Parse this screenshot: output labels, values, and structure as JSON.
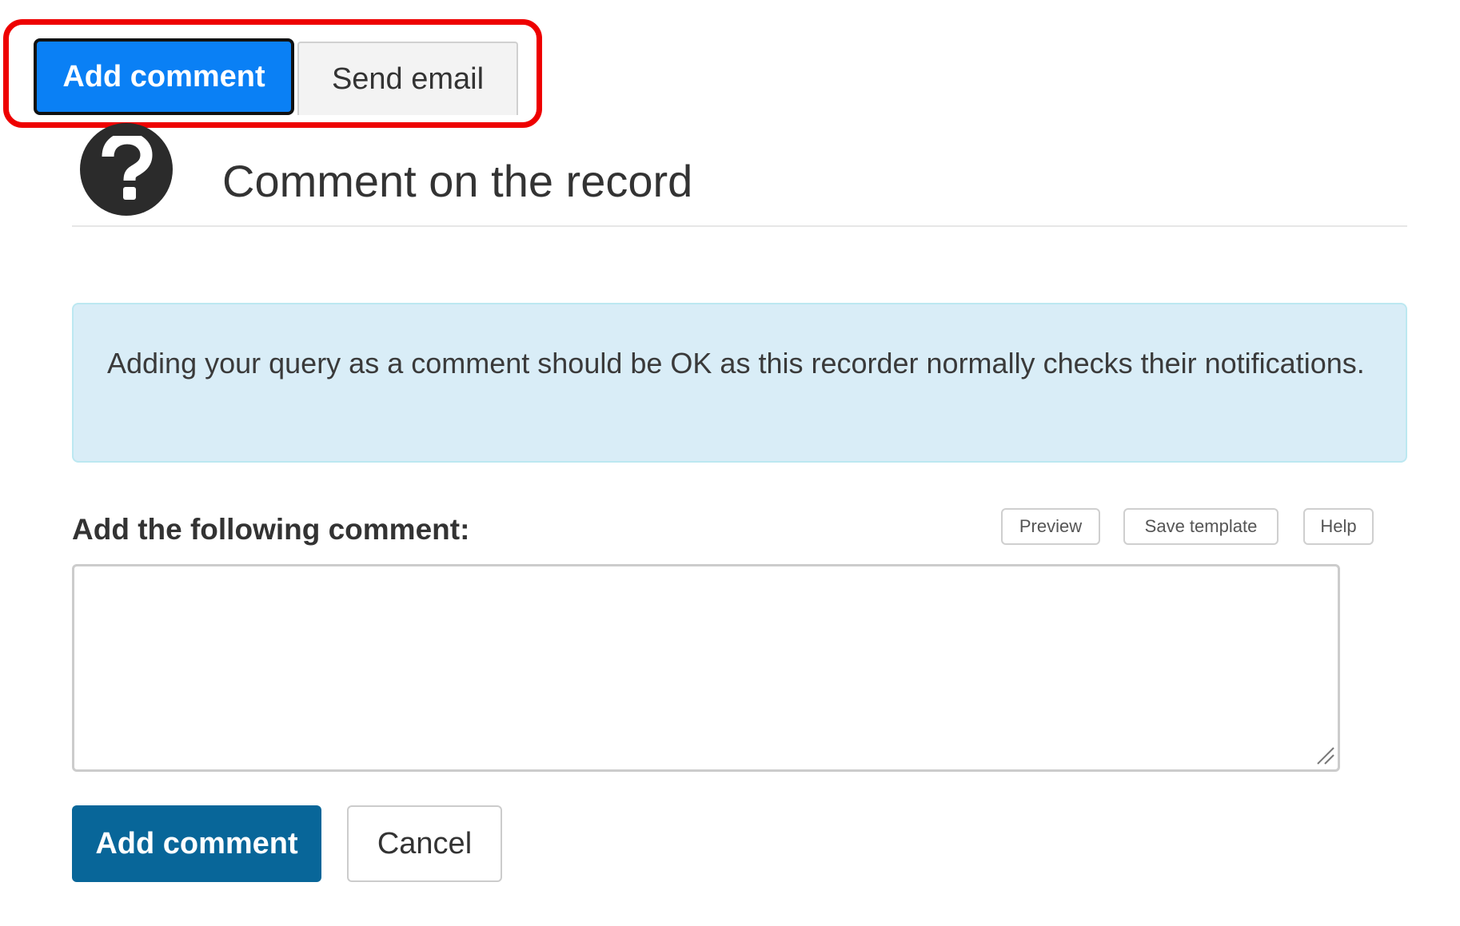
{
  "tabs": [
    {
      "label": "Add comment",
      "active": true
    },
    {
      "label": "Send email",
      "active": false
    }
  ],
  "header": {
    "icon": "question-circle-icon",
    "title": "Comment on the record"
  },
  "info_alert": {
    "text": "Adding your query as a comment should be OK as this recorder normally checks their notifications."
  },
  "comment": {
    "label": "Add the following comment:",
    "value": "",
    "toolbar": {
      "preview_label": "Preview",
      "save_template_label": "Save template",
      "help_label": "Help"
    }
  },
  "actions": {
    "submit_label": "Add comment",
    "cancel_label": "Cancel"
  },
  "colors": {
    "active_tab": "#0a80f5",
    "primary_button": "#086699",
    "info_background": "#d9edf7",
    "highlight": "#ee0000"
  }
}
